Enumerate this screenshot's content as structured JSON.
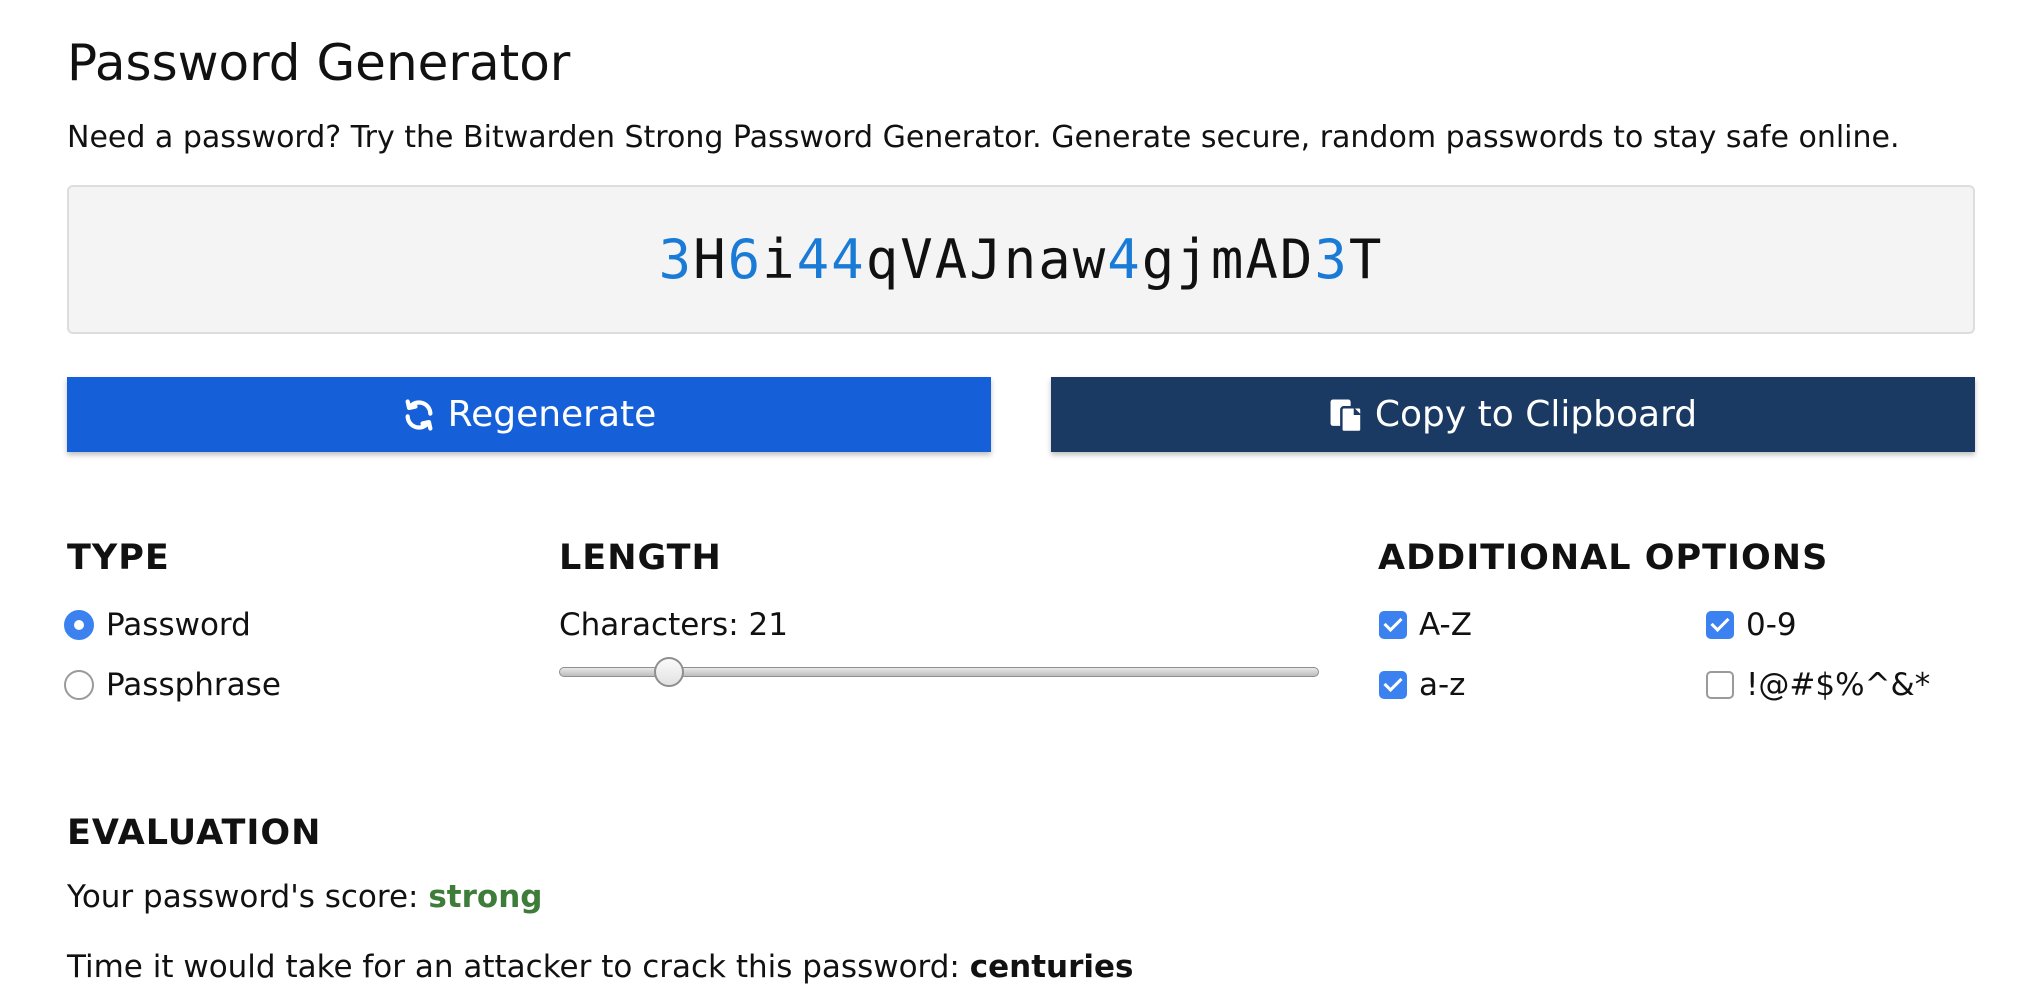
{
  "header": {
    "title": "Password Generator",
    "subtitle": "Need a password? Try the Bitwarden Strong Password Generator. Generate secure, random passwords to stay safe online."
  },
  "password": {
    "segments": [
      {
        "text": "3",
        "digit": true
      },
      {
        "text": "H",
        "digit": false
      },
      {
        "text": "6",
        "digit": true
      },
      {
        "text": "i",
        "digit": false
      },
      {
        "text": "44",
        "digit": true
      },
      {
        "text": "qVAJnaw",
        "digit": false
      },
      {
        "text": "4",
        "digit": true
      },
      {
        "text": "gjmAD",
        "digit": false
      },
      {
        "text": "3",
        "digit": true
      },
      {
        "text": "T",
        "digit": false
      }
    ],
    "digit_color": "#1a7bd6"
  },
  "buttons": {
    "regenerate_label": "Regenerate",
    "regenerate_icon": "refresh-icon",
    "regenerate_color": "#1560d9",
    "copy_label": "Copy to Clipboard",
    "copy_icon": "clipboard-icon",
    "copy_color": "#1a3a64"
  },
  "type": {
    "heading": "TYPE",
    "options": [
      {
        "label": "Password",
        "selected": true
      },
      {
        "label": "Passphrase",
        "selected": false
      }
    ]
  },
  "length": {
    "heading": "LENGTH",
    "characters_label": "Characters: 21",
    "value": 21,
    "min": 5,
    "max": 128
  },
  "additional": {
    "heading": "ADDITIONAL OPTIONS",
    "options": [
      {
        "label": "A-Z",
        "checked": true
      },
      {
        "label": "0-9",
        "checked": true
      },
      {
        "label": "a-z",
        "checked": true
      },
      {
        "label": "!@#$%^&*",
        "checked": false
      }
    ]
  },
  "evaluation": {
    "heading": "EVALUATION",
    "score_prefix": "Your password's score: ",
    "score_value": "strong",
    "score_color": "#3e7c3a",
    "crack_prefix": "Time it would take for an attacker to crack this password: ",
    "crack_value": "centuries"
  }
}
